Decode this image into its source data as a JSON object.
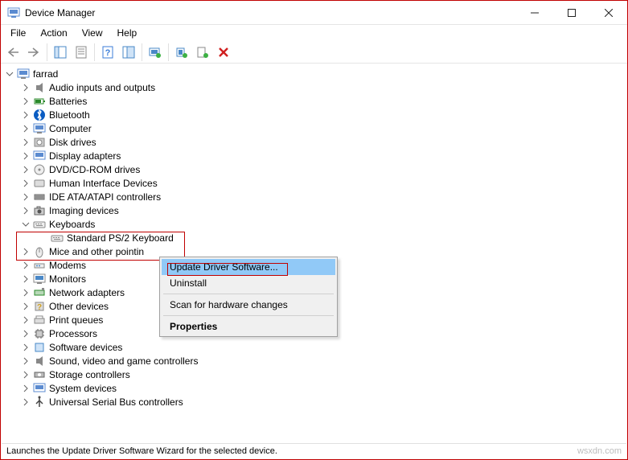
{
  "window": {
    "title": "Device Manager"
  },
  "menu": {
    "file": "File",
    "action": "Action",
    "view": "View",
    "help": "Help"
  },
  "tree": {
    "root": "farrad",
    "items": [
      "Audio inputs and outputs",
      "Batteries",
      "Bluetooth",
      "Computer",
      "Disk drives",
      "Display adapters",
      "DVD/CD-ROM drives",
      "Human Interface Devices",
      "IDE ATA/ATAPI controllers",
      "Imaging devices",
      "Keyboards",
      "Mice and other pointing devices",
      "Modems",
      "Monitors",
      "Network adapters",
      "Other devices",
      "Print queues",
      "Processors",
      "Software devices",
      "Sound, video and game controllers",
      "Storage controllers",
      "System devices",
      "Universal Serial Bus controllers"
    ],
    "keyboards_child": "Standard PS/2 Keyboard",
    "mice_truncated": "Mice and other pointin"
  },
  "context_menu": {
    "update": "Update Driver Software...",
    "uninstall": "Uninstall",
    "scan": "Scan for hardware changes",
    "properties": "Properties"
  },
  "status": "Launches the Update Driver Software Wizard for the selected device.",
  "watermark": "wsxdn.com"
}
